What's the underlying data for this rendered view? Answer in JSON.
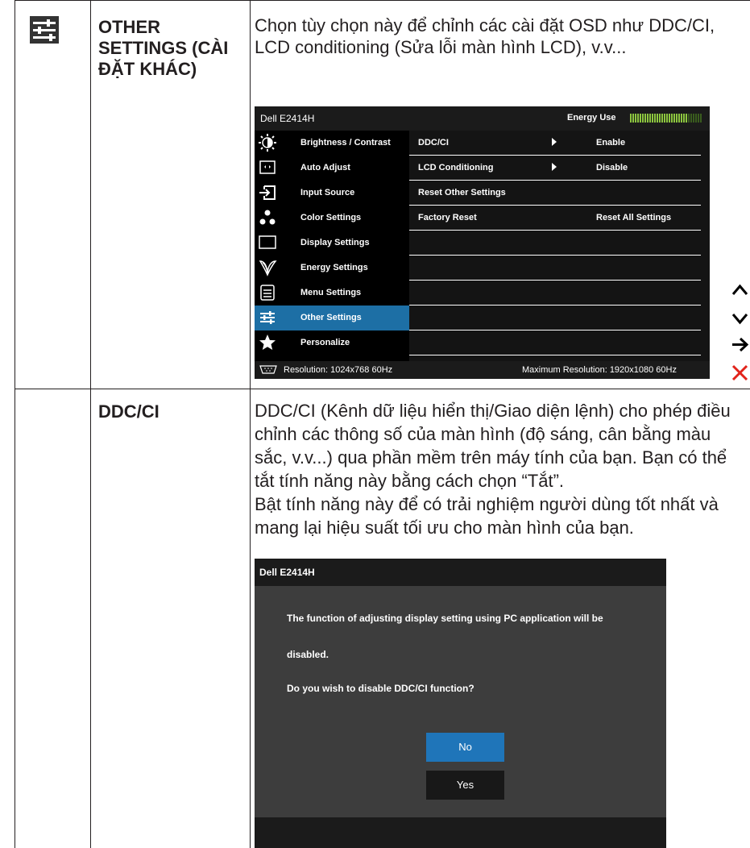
{
  "rows": [
    {
      "icon": "other-settings-sliders-icon",
      "title": "OTHER SETTINGS (CÀI ĐẶT KHÁC)",
      "description": "Chọn tùy chọn này để chỉnh các cài đặt OSD như DDC/CI, LCD conditioning (Sửa lỗi màn hình LCD), v.v..."
    },
    {
      "title": "DDC/CI",
      "description_1": "DDC/CI (Kênh dữ liệu hiển thị/Giao diện lệnh) cho phép điều chỉnh các thông số của màn hình (độ sáng, cân bằng màu sắc, v.v...) qua phần mềm trên máy tính của bạn. Bạn có thể tắt tính năng này bằng cách chọn “Tắt”.",
      "description_2": "Bật tính năng này để có trải nghiệm người dùng tốt nhất và mang lại hiệu suất tối ưu cho màn hình của bạn."
    }
  ],
  "osd_menu": {
    "title": "Dell E2414H",
    "energy_label": "Energy Use",
    "energy_level": 0.8,
    "active_color": "#1d6fa5",
    "menu_items": [
      {
        "label": "Brightness / Contrast",
        "icon": "brightness-icon"
      },
      {
        "label": "Auto Adjust",
        "icon": "auto-adjust-icon"
      },
      {
        "label": "Input Source",
        "icon": "input-source-icon"
      },
      {
        "label": "Color Settings",
        "icon": "color-settings-icon"
      },
      {
        "label": "Display Settings",
        "icon": "display-settings-icon"
      },
      {
        "label": "Energy Settings",
        "icon": "energy-settings-icon"
      },
      {
        "label": "Menu Settings",
        "icon": "menu-settings-icon"
      },
      {
        "label": "Other Settings",
        "icon": "other-settings-icon",
        "active": true
      },
      {
        "label": "Personalize",
        "icon": "personalize-star-icon"
      }
    ],
    "options": [
      {
        "name": "DDC/CI",
        "arrow": true,
        "value": "Enable"
      },
      {
        "name": "LCD Conditioning",
        "arrow": true,
        "value": "Disable"
      },
      {
        "name": "Reset Other Settings",
        "arrow": false,
        "value": ""
      },
      {
        "name": "Factory Reset",
        "arrow": false,
        "value": "Reset All Settings"
      }
    ],
    "resolution": "Resolution: 1024x768 60Hz",
    "max_resolution": "Maximum Resolution: 1920x1080 60Hz"
  },
  "nav_buttons": [
    {
      "icon": "up-arrow-icon"
    },
    {
      "icon": "down-arrow-icon"
    },
    {
      "icon": "enter-arrow-icon"
    },
    {
      "icon": "exit-x-icon"
    }
  ],
  "ddc_dialog": {
    "title": "Dell E2414H",
    "message_line_1": "The function of adjusting display setting using PC application will be",
    "message_line_2": "disabled.",
    "question": "Do you wish to disable DDC/CI function?",
    "no_label": "No",
    "yes_label": "Yes",
    "selected_color": "#1f75b9"
  }
}
